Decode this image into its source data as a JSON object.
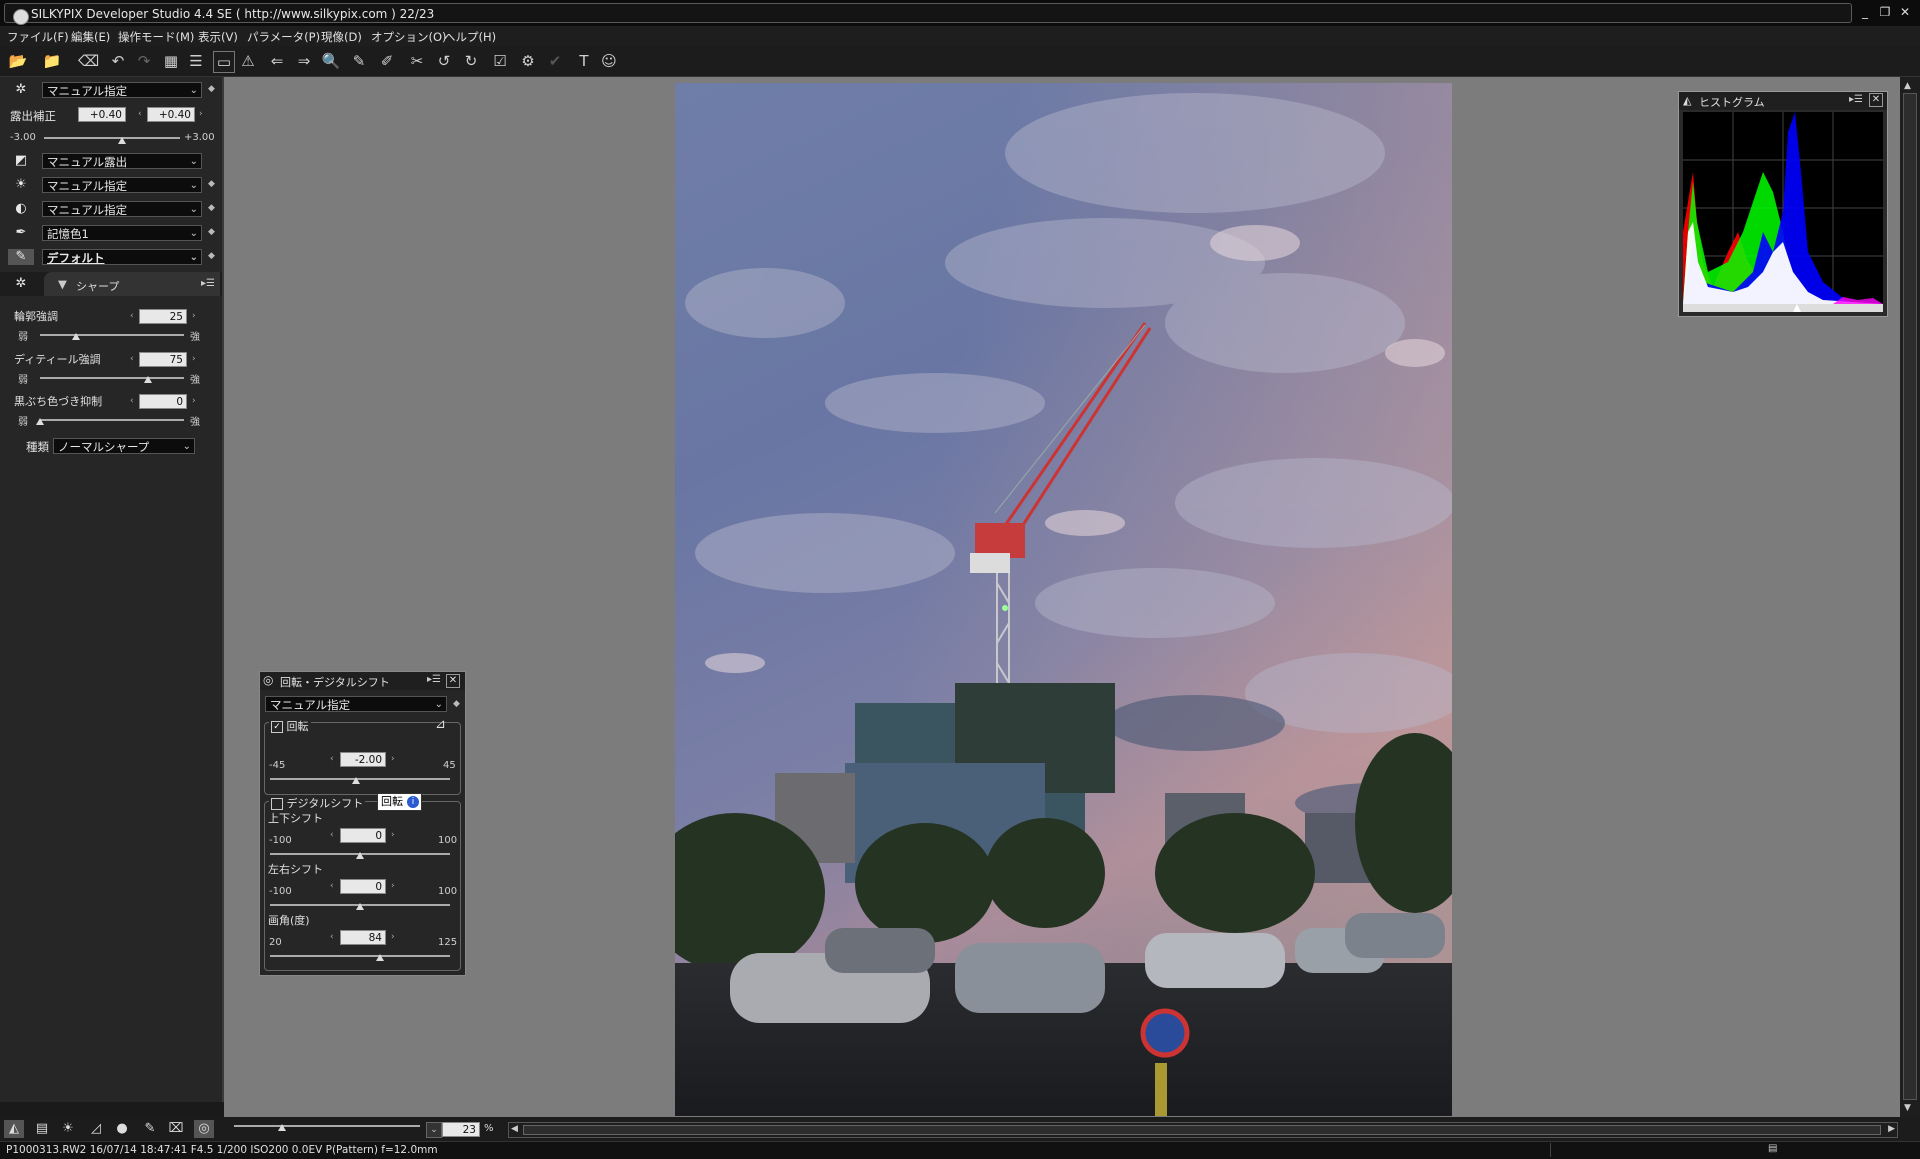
{
  "window": {
    "title": "SILKYPIX Developer Studio 4.4 SE ( http://www.silkypix.com )   22/23"
  },
  "menu": [
    "ファイル(F)",
    "編集(E)",
    "操作モード(M)",
    "表示(V)",
    "パラメータ(P)",
    "現像(D)",
    "オプション(O)",
    "ヘルプ(H)"
  ],
  "left_panel": {
    "preset_wb": "マニュアル指定",
    "exposure_label": "露出補正",
    "exposure_value1": "+0.40",
    "exposure_value2": "+0.40",
    "exposure_min": "-3.00",
    "exposure_max": "+3.00",
    "exposure_slider": 0.57,
    "tone_preset": "マニュアル露出",
    "wb_preset": "マニュアル指定",
    "contrast_preset": "マニュアル指定",
    "color_preset": "記憶色1",
    "style_preset": "デフォルト",
    "sharp_header": "シャープ",
    "outline_label": "輪郭強調",
    "outline_value": "25",
    "outline_slider": 0.25,
    "detail_label": "ディティール強調",
    "detail_value": "75",
    "detail_slider": 0.75,
    "edge_label": "黒ぶち色づき抑制",
    "edge_value": "0",
    "edge_slider": 0.0,
    "weak": "弱",
    "strong": "強",
    "type_label": "種類",
    "type_value": "ノーマルシャープ"
  },
  "histogram": {
    "title": "ヒストグラム"
  },
  "rotation_panel": {
    "title": "回転・デジタルシフト",
    "preset": "マニュアル指定",
    "rotate_label": "回転",
    "rotate_min": "-45",
    "rotate_max": "45",
    "rotate_value": "-2.00",
    "rotate_slider": 0.478,
    "shift_label": "デジタルシフト",
    "tooltip": "回転",
    "vshift_label": "上下シフト",
    "vshift_min": "-100",
    "vshift_max": "100",
    "vshift_value": "0",
    "vshift_slider": 0.5,
    "hshift_label": "左右シフト",
    "hshift_min": "-100",
    "hshift_max": "100",
    "hshift_value": "0",
    "hshift_slider": 0.5,
    "angle_label": "画角(度)",
    "angle_min": "20",
    "angle_max": "125",
    "angle_value": "84",
    "angle_slider": 0.61
  },
  "zoom": {
    "value": "23",
    "unit": "%",
    "slider": 0.26
  },
  "status": {
    "text": "P1000313.RW2 16/07/14 18:47:41 F4.5 1/200 ISO200  0.0EV P(Pattern) f=12.0mm"
  }
}
